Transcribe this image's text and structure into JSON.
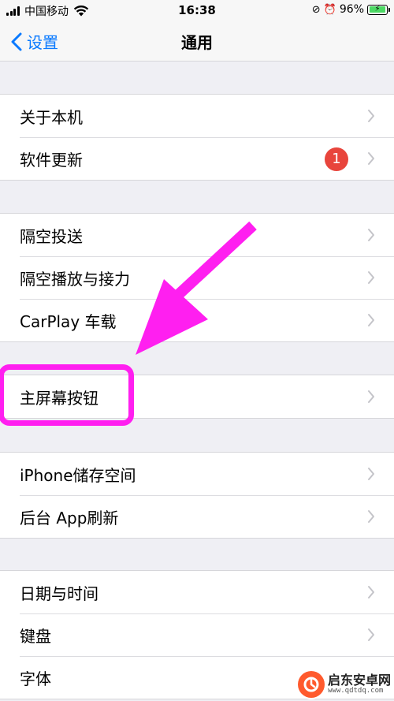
{
  "status_bar": {
    "carrier": "中国移动",
    "time": "16:38",
    "battery_percent": "96%",
    "battery_level": 0.96,
    "icons": [
      "signal-icon",
      "wifi-icon",
      "orientation-lock-icon",
      "alarm-icon",
      "battery-icon"
    ]
  },
  "nav": {
    "back_label": "设置",
    "title": "通用"
  },
  "groups": [
    {
      "rows": [
        {
          "label": "关于本机"
        },
        {
          "label": "软件更新",
          "badge": "1"
        }
      ]
    },
    {
      "rows": [
        {
          "label": "隔空投送"
        },
        {
          "label": "隔空播放与接力"
        },
        {
          "label": "CarPlay 车载"
        }
      ]
    },
    {
      "rows": [
        {
          "label": "主屏幕按钮"
        }
      ]
    },
    {
      "rows": [
        {
          "label": "iPhone储存空间"
        },
        {
          "label": "后台 App刷新"
        }
      ]
    },
    {
      "rows": [
        {
          "label": "日期与时间"
        },
        {
          "label": "键盘"
        },
        {
          "label": "字体"
        }
      ]
    }
  ],
  "annotation": {
    "color": "#ff1ff0"
  },
  "watermark": {
    "name": "启东安卓网",
    "url": "www.qdtdq.com"
  },
  "colors": {
    "accent": "#0a7aff",
    "badge": "#e8453c",
    "background": "#efeff4"
  }
}
